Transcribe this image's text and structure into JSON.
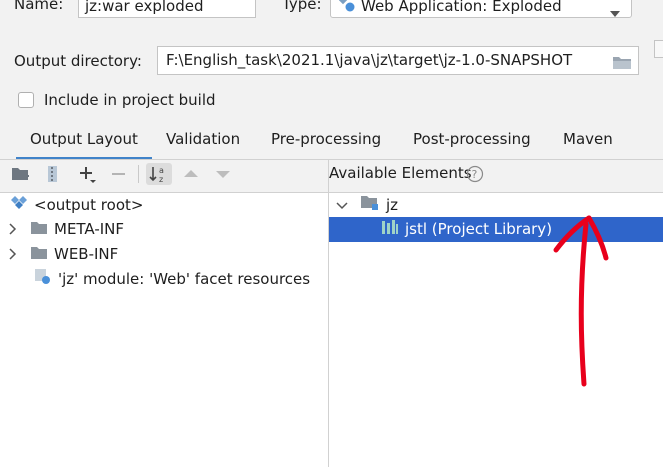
{
  "top": {
    "name_label": "Name:",
    "name_value": "jz:war exploded",
    "type_label": "Type:",
    "type_value": "Web Application: Exploded"
  },
  "output": {
    "label": "Output directory:",
    "value": "F:\\English_task\\2021.1\\java\\jz\\target\\jz-1.0-SNAPSHOT"
  },
  "include_build": {
    "label": "Include in project build",
    "checked": false
  },
  "tabs": [
    "Output Layout",
    "Validation",
    "Pre-processing",
    "Post-processing",
    "Maven"
  ],
  "left_tree": {
    "items": [
      {
        "label": "<output root>",
        "icon": "output-root-icon"
      },
      {
        "label": "META-INF",
        "icon": "folder-icon"
      },
      {
        "label": "WEB-INF",
        "icon": "folder-icon"
      },
      {
        "label": "'jz' module: 'Web' facet resources",
        "icon": "web-facet-icon"
      }
    ]
  },
  "available": {
    "title": "Available Elements",
    "items": [
      {
        "label": "jz",
        "icon": "module-folder-icon"
      },
      {
        "label": "jstl (Project Library)",
        "icon": "library-icon",
        "selected": true
      }
    ]
  },
  "colors": {
    "selection": "#2f65ca",
    "tab_underline": "#4083c9",
    "annotation": "#e8001c"
  }
}
